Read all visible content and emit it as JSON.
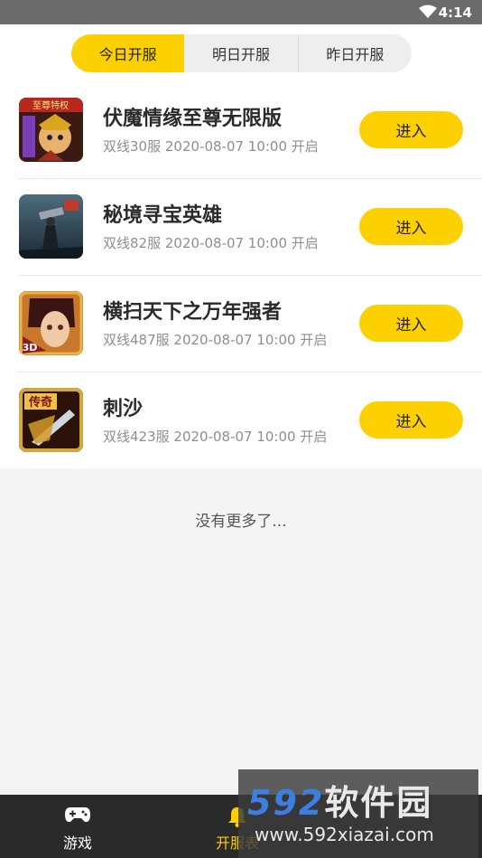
{
  "status_bar": {
    "time": "4:14"
  },
  "tabs": [
    {
      "label": "今日开服",
      "active": true
    },
    {
      "label": "明日开服",
      "active": false
    },
    {
      "label": "昨日开服",
      "active": false
    }
  ],
  "servers": [
    {
      "name": "伏魔情缘至尊无限版",
      "info": "双线30服 2020-08-07 10:00 开启",
      "button": "进入",
      "icon_text": "至尊特权"
    },
    {
      "name": "秘境寻宝英雄",
      "info": "双线82服 2020-08-07 10:00 开启",
      "button": "进入",
      "icon_text": ""
    },
    {
      "name": "横扫天下之万年强者",
      "info": "双线487服 2020-08-07 10:00 开启",
      "button": "进入",
      "icon_text": "3D"
    },
    {
      "name": "刺沙",
      "info": "双线423服 2020-08-07 10:00 开启",
      "button": "进入",
      "icon_text": "传奇"
    }
  ],
  "no_more": "没有更多了...",
  "bottom_nav": [
    {
      "label": "游戏",
      "icon": "gamepad-icon"
    },
    {
      "label": "开服表",
      "icon": "bell-icon"
    }
  ],
  "watermark": {
    "big_num": "592",
    "big_cn": "软件园",
    "url": "www.592xiazai.com"
  },
  "colors": {
    "accent": "#fdd000",
    "nav_bg": "#2a2a2a"
  }
}
